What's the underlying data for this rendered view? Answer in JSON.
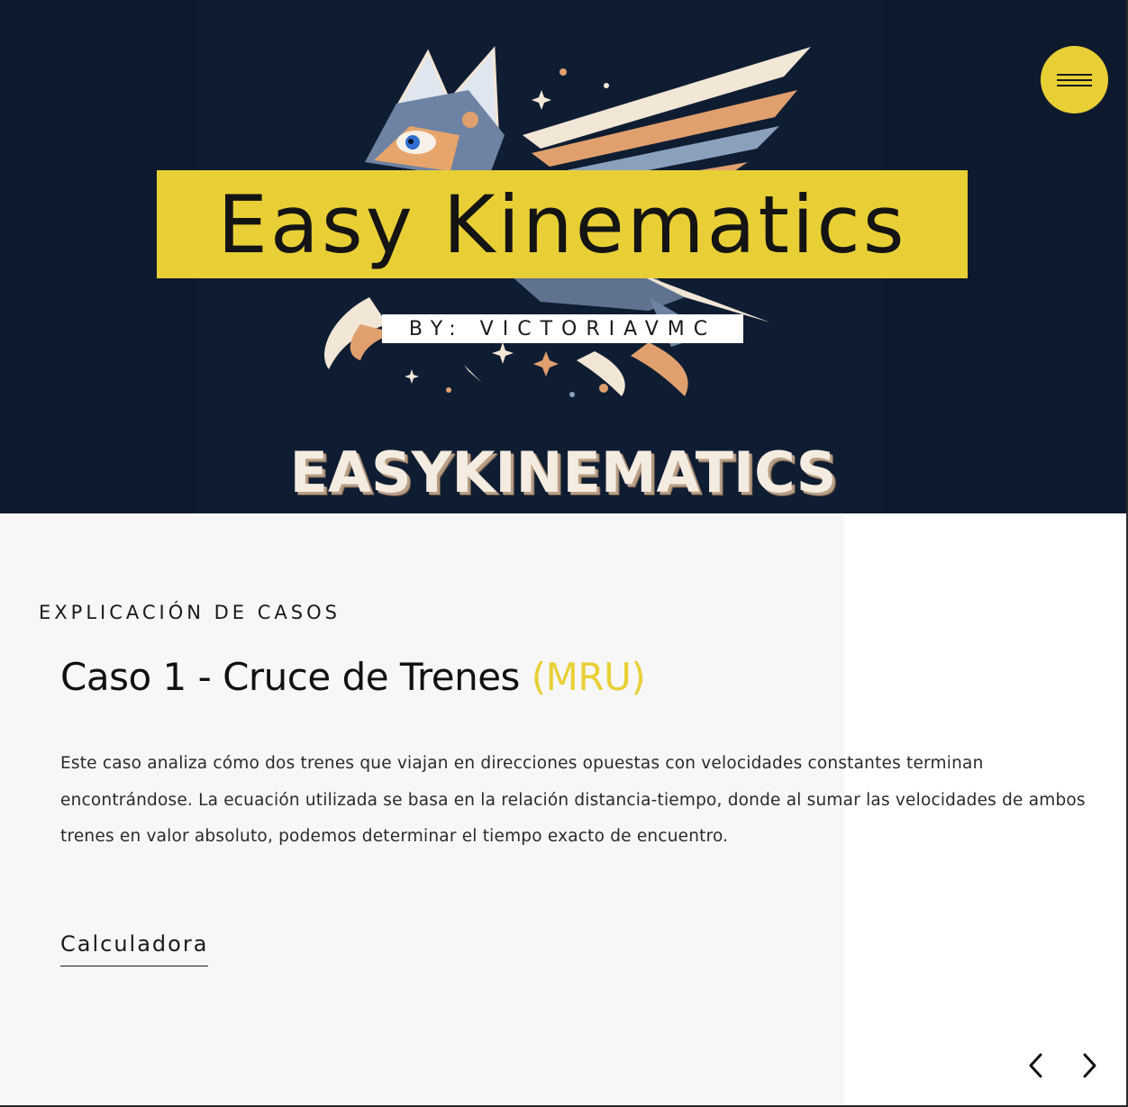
{
  "hero": {
    "title": "Easy Kinematics",
    "byline": "BY: VICTORIAVMC",
    "brand_word": "EASYKINEMATICS",
    "logo_icon": "winged-cat-logo",
    "menu_icon": "hamburger-menu-icon"
  },
  "section": {
    "eyebrow": "EXPLICACIÓN DE CASOS",
    "title_main": "Caso 1 - Cruce de Trenes ",
    "title_accent": "(MRU)",
    "description": "Este caso analiza cómo dos trenes que viajan en direcciones opuestas con velocidades constantes terminan encontrándose. La ecuación utilizada se basa en la relación distancia-tiempo, donde al sumar las velocidades de ambos trenes en valor absoluto, podemos determinar el tiempo exacto de encuentro.",
    "link_label": "Calculadora"
  },
  "carousel": {
    "prev_icon": "chevron-left-icon",
    "next_icon": "chevron-right-icon"
  },
  "colors": {
    "accent": "#e8cf35",
    "hero_bg": "#0d1a2d",
    "content_bg": "#f7f7f7"
  }
}
